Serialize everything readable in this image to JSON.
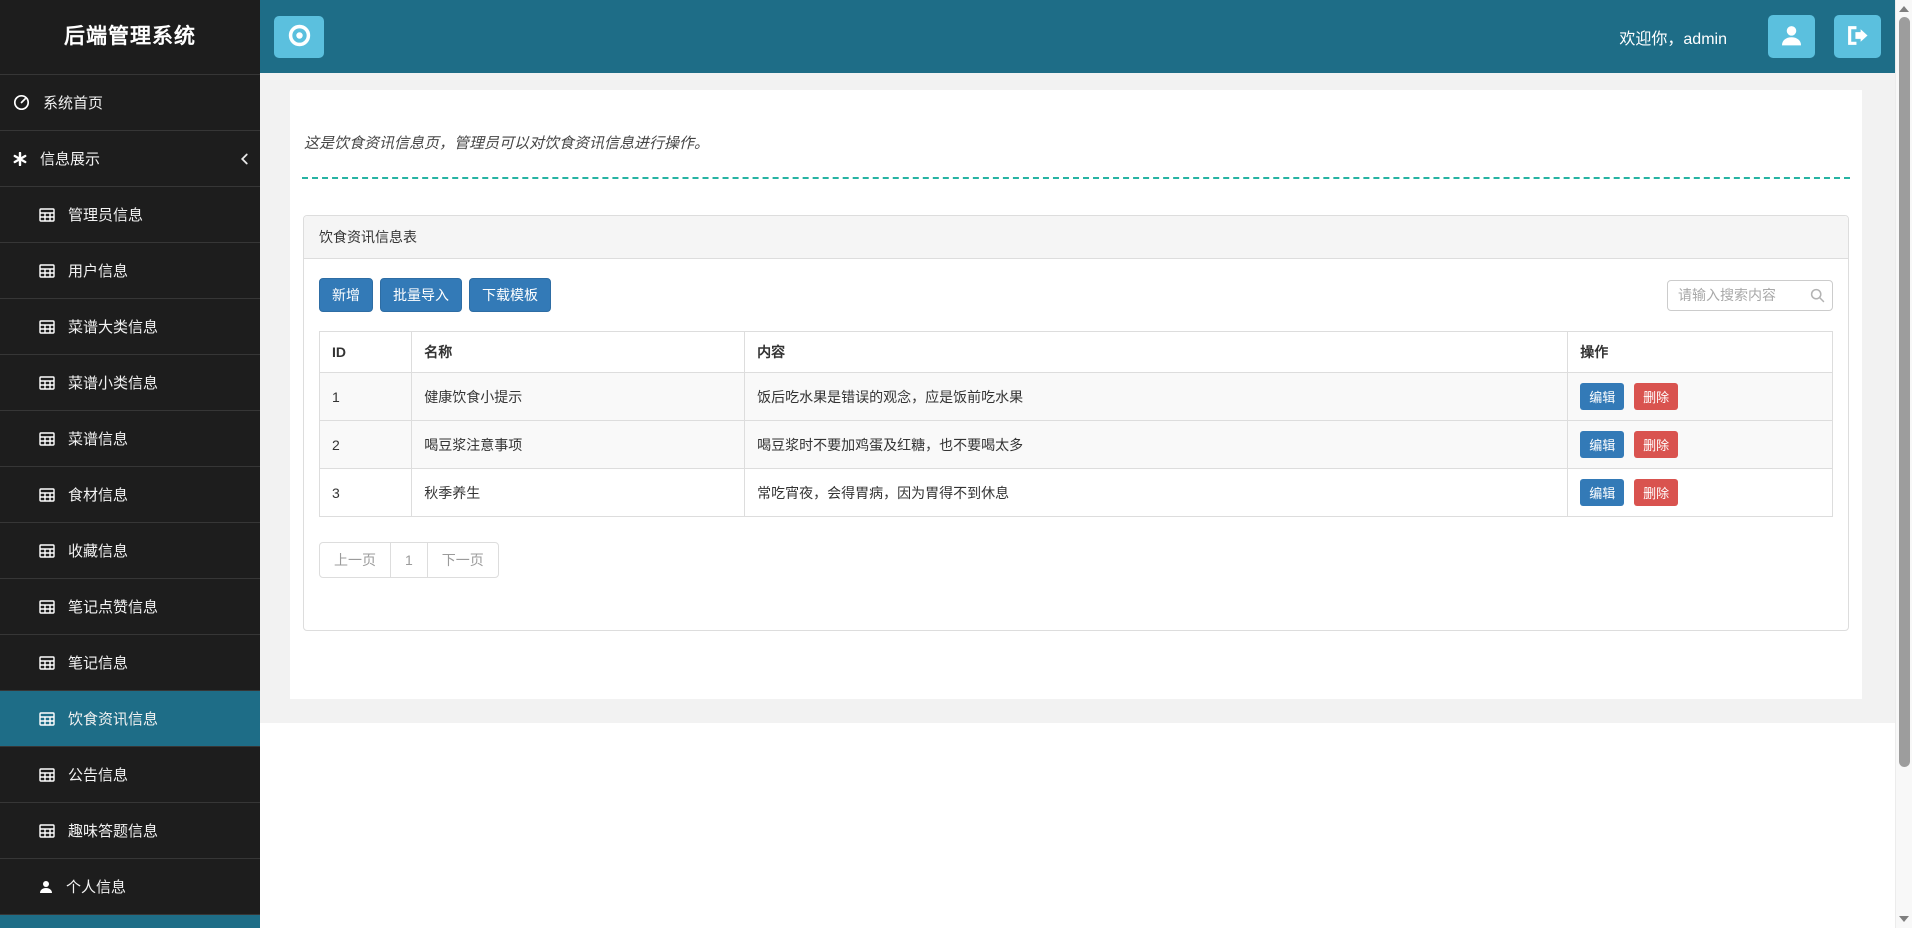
{
  "app": {
    "title": "后端管理系统"
  },
  "topbar": {
    "welcome": "欢迎你，admin",
    "icons": {
      "logo": "bullseye-icon",
      "profile": "user-icon",
      "logout": "sign-out-icon"
    }
  },
  "sidebar": {
    "items": [
      {
        "label": "系统首页",
        "icon": "dashboard-icon",
        "level": "top",
        "active": false
      },
      {
        "label": "信息展示",
        "icon": "asterisk-icon",
        "level": "top",
        "active": false,
        "chevron": "collapse-chevron-icon"
      },
      {
        "label": "管理员信息",
        "icon": "table-icon",
        "level": "sub",
        "active": false
      },
      {
        "label": "用户信息",
        "icon": "table-icon",
        "level": "sub",
        "active": false
      },
      {
        "label": "菜谱大类信息",
        "icon": "table-icon",
        "level": "sub",
        "active": false
      },
      {
        "label": "菜谱小类信息",
        "icon": "table-icon",
        "level": "sub",
        "active": false
      },
      {
        "label": "菜谱信息",
        "icon": "table-icon",
        "level": "sub",
        "active": false
      },
      {
        "label": "食材信息",
        "icon": "table-icon",
        "level": "sub",
        "active": false
      },
      {
        "label": "收藏信息",
        "icon": "table-icon",
        "level": "sub",
        "active": false
      },
      {
        "label": "笔记点赞信息",
        "icon": "table-icon",
        "level": "sub",
        "active": false
      },
      {
        "label": "笔记信息",
        "icon": "table-icon",
        "level": "sub",
        "active": false
      },
      {
        "label": "饮食资讯信息",
        "icon": "table-icon",
        "level": "sub",
        "active": true
      },
      {
        "label": "公告信息",
        "icon": "table-icon",
        "level": "sub",
        "active": false
      },
      {
        "label": "趣味答题信息",
        "icon": "table-icon",
        "level": "sub",
        "active": false
      },
      {
        "label": "个人信息",
        "icon": "user-icon",
        "level": "sub",
        "active": false
      }
    ]
  },
  "main": {
    "description": "这是饮食资讯信息页，管理员可以对饮食资讯信息进行操作。",
    "panel": {
      "title": "饮食资讯信息表"
    },
    "toolbar": {
      "add": "新增",
      "batch_import": "批量导入",
      "download_template": "下载模板"
    },
    "search": {
      "placeholder": "请输入搜索内容",
      "icon": "search-icon"
    },
    "table": {
      "headers": {
        "id": "ID",
        "name": "名称",
        "content": "内容",
        "actions": "操作"
      },
      "rows": [
        {
          "id": "1",
          "name": "健康饮食小提示",
          "content": "饭后吃水果是错误的观念，应是饭前吃水果"
        },
        {
          "id": "2",
          "name": "喝豆浆注意事项",
          "content": "喝豆浆时不要加鸡蛋及红糖，也不要喝太多"
        },
        {
          "id": "3",
          "name": "秋季养生",
          "content": "常吃宵夜，会得胃病，因为胃得不到休息"
        }
      ],
      "row_actions": {
        "edit": "编辑",
        "delete": "删除"
      }
    },
    "pagination": {
      "prev": "上一页",
      "current": "1",
      "next": "下一页"
    }
  },
  "colors": {
    "header_teal": "#1e6d87",
    "accent_light_blue": "#5bc0de",
    "primary_blue": "#337ab7",
    "danger_red": "#d9534f",
    "dashed_divider_teal": "#26b3a3",
    "sidebar_bg": "#1d1d1d"
  }
}
